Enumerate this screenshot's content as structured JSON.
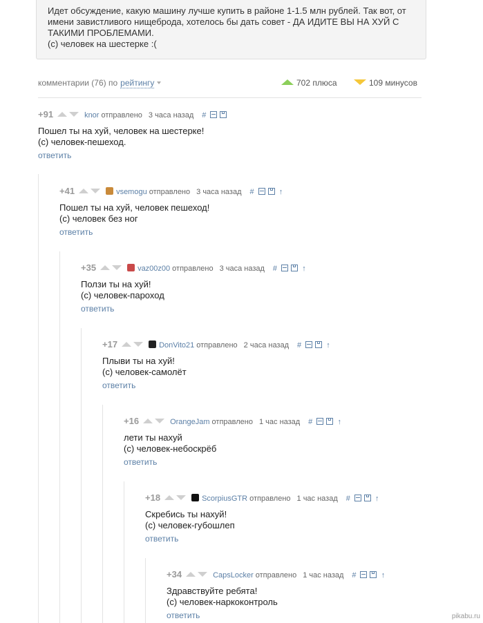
{
  "post": {
    "text": "Идет обсуждение, какую машину лучше купить в районе 1-1.5 млн рублей. Так вот, от\nимени завистливого нищеброда, хотелось бы дать совет - ДА ИДИТЕ ВЫ НА ХУЙ С\nТАКИМИ ПРОБЛЕМАМИ.\n(с) человек на шестерке :("
  },
  "meta": {
    "comments_label": "комментарии (76) по",
    "sort_label": "рейтингу",
    "pluses": "702 плюса",
    "minuses": "109 минусов"
  },
  "comments": [
    {
      "rating": "+91",
      "author": "knor",
      "sent": "отправлено",
      "time": "3 часа назад",
      "body": "Пошел ты на хуй, человек на шестерке!\n(с) человек-пешеход.",
      "reply": "ответить",
      "avatar_color": ""
    },
    {
      "rating": "+41",
      "author": "vsemogu",
      "sent": "отправлено",
      "time": "3 часа назад",
      "body": "Пошел ты на хуй, человек пешеход!\n(с) человек без ног",
      "reply": "ответить",
      "avatar_color": "#c98a3a"
    },
    {
      "rating": "+35",
      "author": "vaz00z00",
      "sent": "отправлено",
      "time": "3 часа назад",
      "body": "Ползи ты на хуй!\n(с) человек-пароход",
      "reply": "ответить",
      "avatar_color": "#c94a4a"
    },
    {
      "rating": "+17",
      "author": "DonVito21",
      "sent": "отправлено",
      "time": "2 часа назад",
      "body": "Плыви ты на хуй!\n(с) человек-самолёт",
      "reply": "ответить",
      "avatar_color": "#222222"
    },
    {
      "rating": "+16",
      "author": "OrangeJam",
      "sent": "отправлено",
      "time": "1 час назад",
      "body": "лети ты нахуй\n(с) человек-небоскрёб",
      "reply": "ответить",
      "avatar_color": ""
    },
    {
      "rating": "+18",
      "author": "ScorpiusGTR",
      "sent": "отправлено",
      "time": "1 час назад",
      "body": "Скребись ты нахуй!\n(с) человек-губошлеп",
      "reply": "ответить",
      "avatar_color": "#111111"
    },
    {
      "rating": "+34",
      "author": "CapsLocker",
      "sent": "отправлено",
      "time": "1 час назад",
      "body": "Здравствуйте ребята!\n(с) человек-наркоконтроль",
      "reply": "ответить",
      "avatar_color": ""
    }
  ],
  "tool_icons": [
    "hash-icon",
    "collapse-icon",
    "save-icon",
    "parent-arrow-icon"
  ],
  "watermark": "pikabu.ru",
  "colors": {
    "link": "#5b7fa6",
    "plus": "#8ccf5a",
    "minus": "#f5c73a"
  }
}
